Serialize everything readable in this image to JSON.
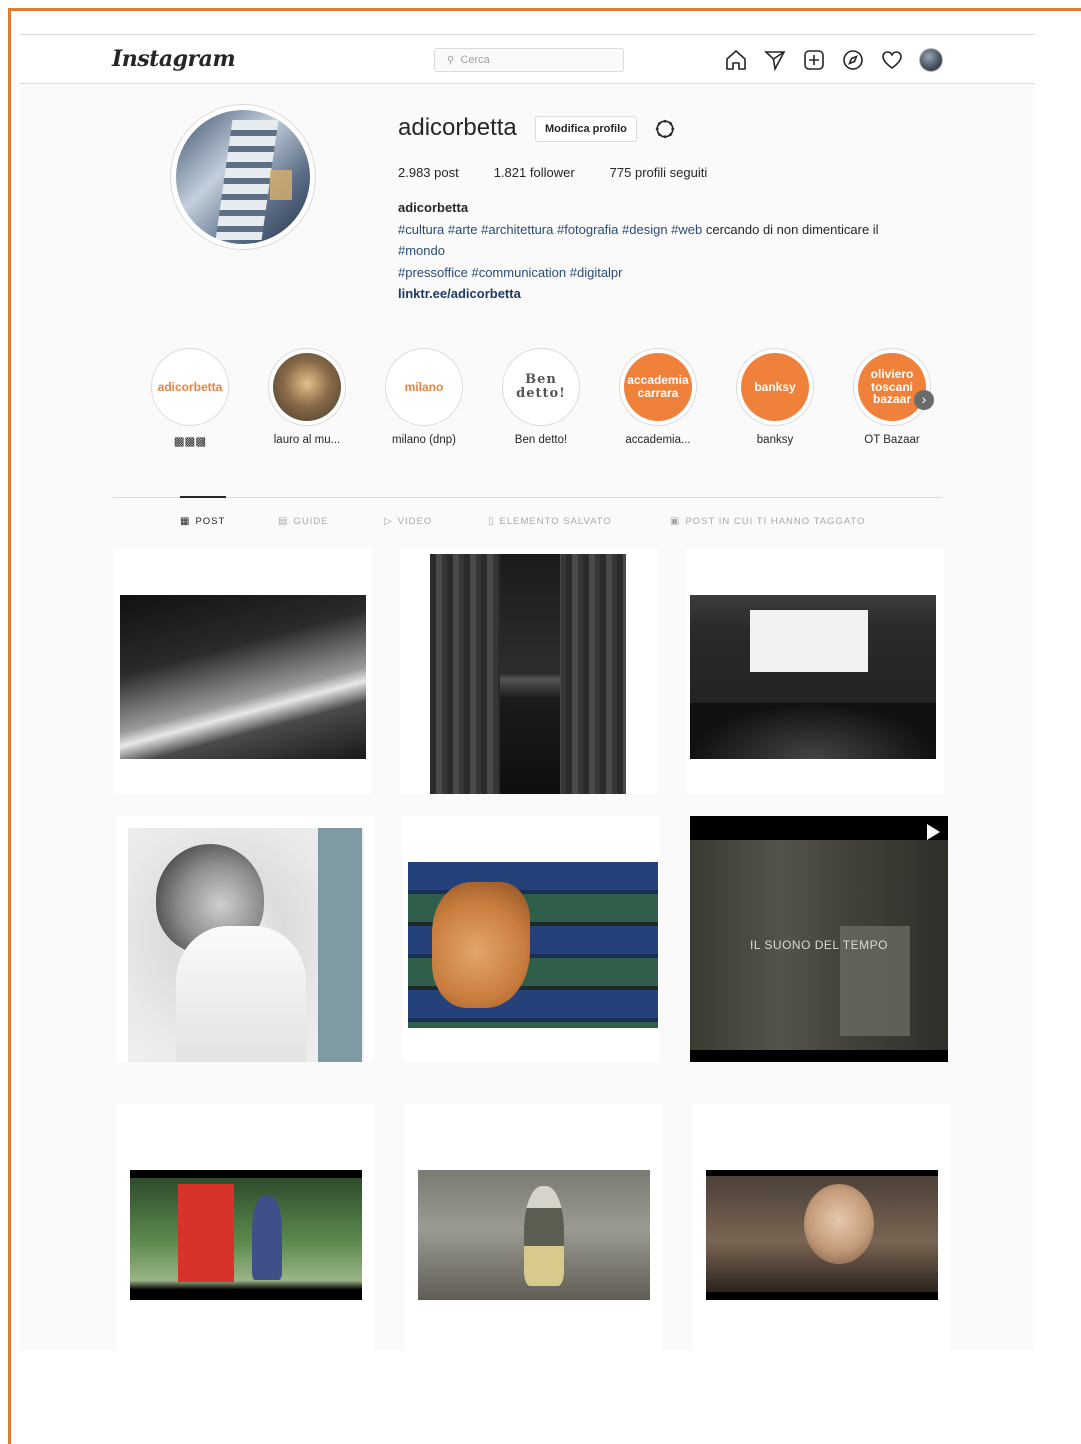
{
  "header": {
    "logo": "Instagram",
    "search_placeholder": "Cerca",
    "nav_icons": [
      "home-icon",
      "direct-icon",
      "new-post-icon",
      "explore-icon",
      "activity-icon",
      "profile-avatar"
    ]
  },
  "profile": {
    "username": "adicorbetta",
    "edit_button": "Modifica profilo",
    "stats": {
      "posts": "2.983 post",
      "followers": "1.821 follower",
      "following": "775 profili seguiti"
    },
    "bio_name": "adicorbetta",
    "bio_line1": "#cultura #arte #architettura #fotografia #design #web",
    "bio_line1_plain": " cercando di non dimenticare il",
    "bio_line2": "#mondo",
    "bio_line3": "#pressoffice #communication #digitalpr",
    "link": "linktr.ee/adicorbetta"
  },
  "highlights": [
    {
      "cover_text": "adicorbetta",
      "label": "▩▩▩",
      "style": "white"
    },
    {
      "cover_text": "",
      "label": "lauro al mu...",
      "style": "photo1"
    },
    {
      "cover_text": "milano",
      "label": "milano (dnp)",
      "style": "white"
    },
    {
      "cover_text": "Ben detto!",
      "label": "Ben detto!",
      "style": "stamp"
    },
    {
      "cover_text": "accademia carrara",
      "label": "accademia...",
      "style": "orange"
    },
    {
      "cover_text": "banksy",
      "label": "banksy",
      "style": "orange"
    },
    {
      "cover_text": "oliviero toscani bazaar",
      "label": "OT Bazaar",
      "style": "orange"
    }
  ],
  "tabs": [
    {
      "label": "POST",
      "icon": "▦"
    },
    {
      "label": "GUIDE",
      "icon": "▤"
    },
    {
      "label": "VIDEO",
      "icon": "▷"
    },
    {
      "label": "ELEMENTO SALVATO",
      "icon": "▯"
    },
    {
      "label": "POST IN CUI TI HANNO TAGGATO",
      "icon": "▣"
    }
  ],
  "posts": [
    {
      "kind": "theatre-stage"
    },
    {
      "kind": "curtain"
    },
    {
      "kind": "cinema-hall"
    },
    {
      "kind": "portrait-woman"
    },
    {
      "kind": "hand-on-glass"
    },
    {
      "kind": "video",
      "caption": "IL SUONO DEL TEMPO"
    },
    {
      "kind": "red-sculpture"
    },
    {
      "kind": "man-on-bench"
    },
    {
      "kind": "woman-speaking"
    }
  ],
  "colors": {
    "accent_orange": "#f0813a",
    "border_orange": "#e07a34",
    "hashtag_blue": "#2a4b75"
  }
}
